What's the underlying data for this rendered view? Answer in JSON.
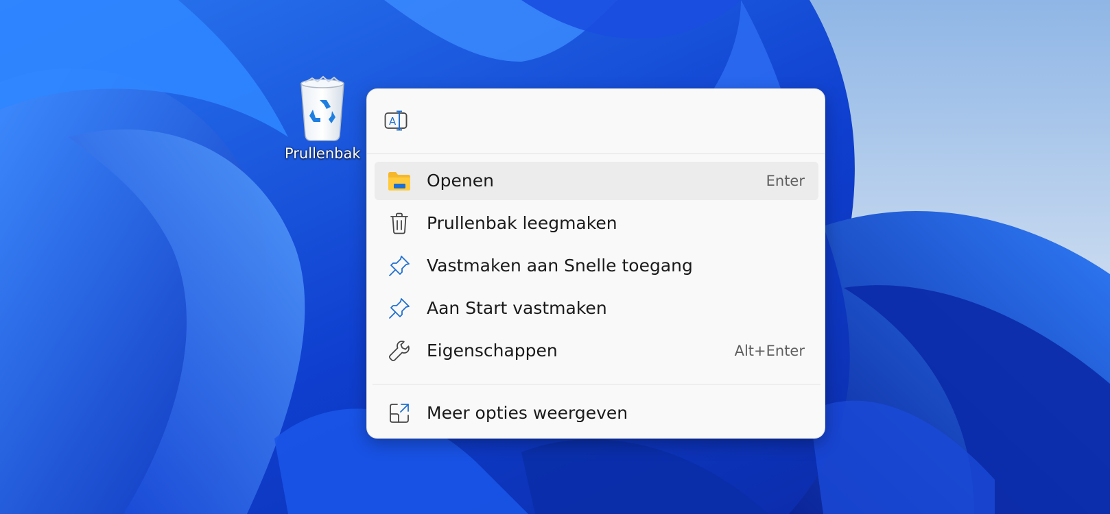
{
  "desktop": {
    "recycle_bin_label": "Prullenbak"
  },
  "context_menu": {
    "quick_actions": [
      {
        "icon": "rename-icon"
      }
    ],
    "items": [
      {
        "label": "Openen",
        "shortcut": "Enter",
        "icon": "folder-icon",
        "highlighted": true
      },
      {
        "label": "Prullenbak leegmaken",
        "shortcut": "",
        "icon": "trash-icon"
      },
      {
        "label": "Vastmaken aan Snelle toegang",
        "shortcut": "",
        "icon": "pin-icon"
      },
      {
        "label": "Aan Start vastmaken",
        "shortcut": "",
        "icon": "pin-icon"
      },
      {
        "label": "Eigenschappen",
        "shortcut": "Alt+Enter",
        "icon": "wrench-icon"
      }
    ],
    "more_options": {
      "label": "Meer opties weergeven",
      "icon": "share-icon"
    }
  },
  "colors": {
    "accent": "#1f6fd1",
    "menu_bg": "#f9f9f9",
    "highlight_bg": "#ececec",
    "wallpaper_primary": "#1c4fd6",
    "wallpaper_sky": "#b8d0ec"
  }
}
